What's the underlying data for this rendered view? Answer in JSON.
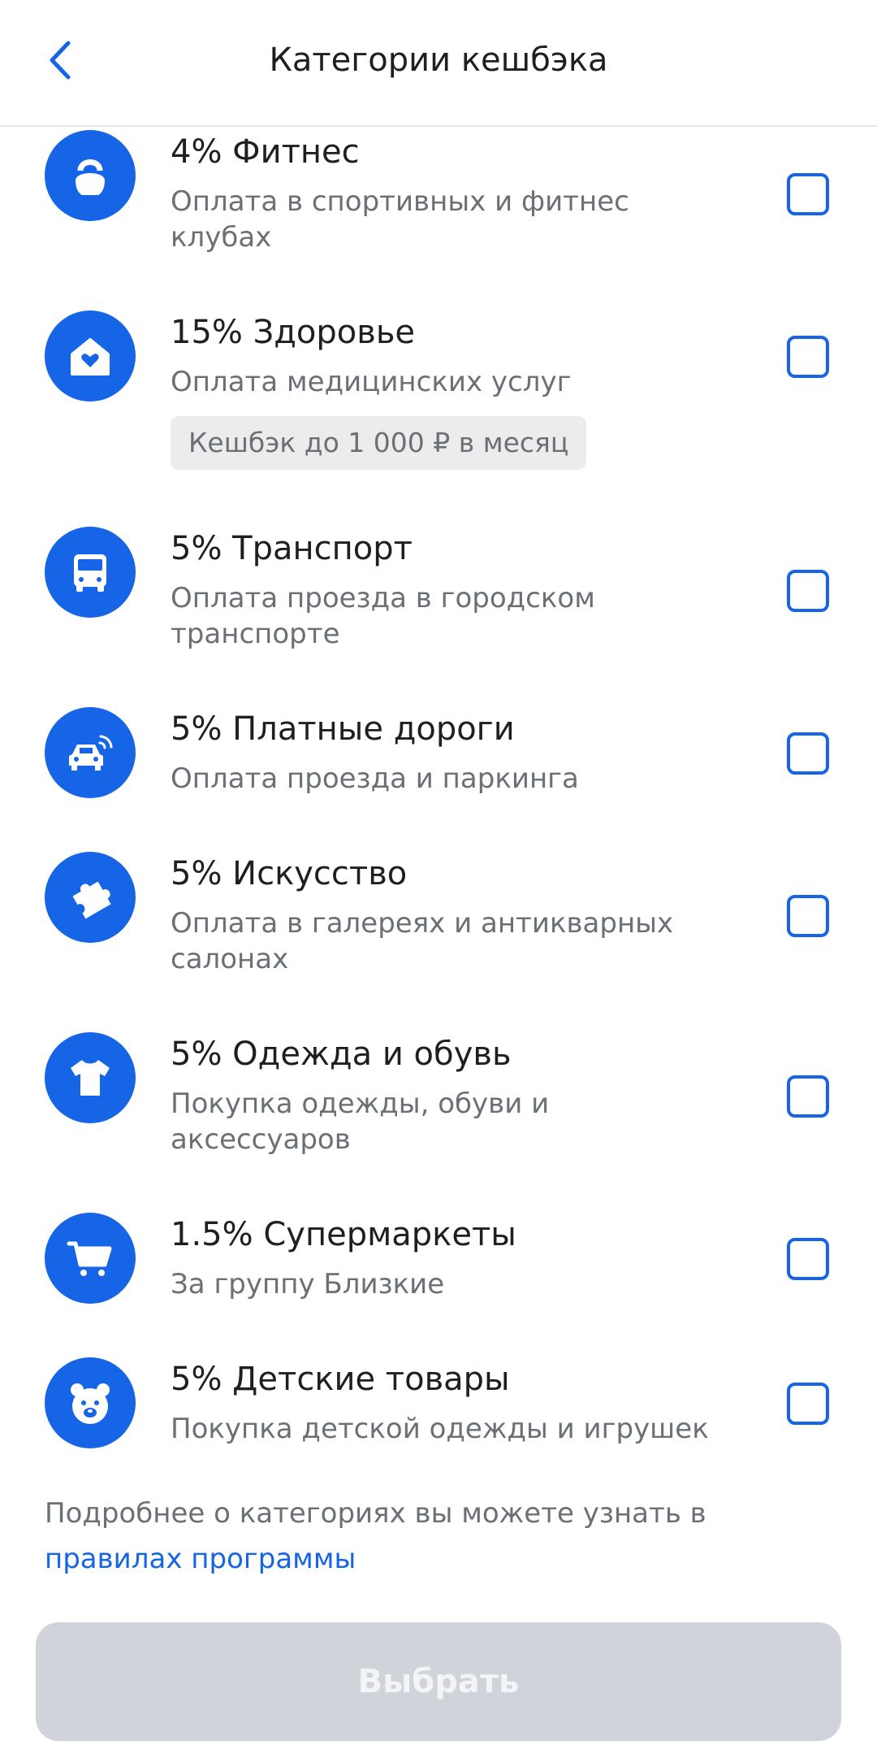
{
  "header": {
    "title": "Категории кешбэка",
    "back_icon": "chevron-left-icon"
  },
  "categories": [
    {
      "title": "4% Фитнес",
      "description": "Оплата в спортивных и фитнес клубах",
      "icon": "kettlebell-icon",
      "checked": false
    },
    {
      "title": "15% Здоровье",
      "description": "Оплата медицинских услуг",
      "badge": "Кешбэк до 1 000 ₽ в месяц",
      "icon": "home-heart-icon",
      "checked": false
    },
    {
      "title": "5% Транспорт",
      "description": "Оплата проезда в городском транспорте",
      "icon": "bus-icon",
      "checked": false
    },
    {
      "title": "5% Платные дороги",
      "description": "Оплата проезда и паркинга",
      "icon": "car-signal-icon",
      "checked": false
    },
    {
      "title": "5% Искусство",
      "description": "Оплата в галереях и антикварных салонах",
      "icon": "puzzle-icon",
      "checked": false
    },
    {
      "title": "5% Одежда и обувь",
      "description": "Покупка одежды, обуви и аксессуаров",
      "icon": "tshirt-icon",
      "checked": false
    },
    {
      "title": "1.5% Супермаркеты",
      "description": "За группу Близкие",
      "icon": "cart-icon",
      "checked": false
    },
    {
      "title": "5% Детские товары",
      "description": "Покупка детской одежды и игрушек",
      "icon": "bear-icon",
      "checked": false
    }
  ],
  "footer": {
    "note": "Подробнее о категориях вы можете узнать в",
    "link": "правилах программы"
  },
  "action": {
    "select_label": "Выбрать"
  },
  "colors": {
    "accent": "#1565e6",
    "disabled_button": "#d0d3d9"
  }
}
